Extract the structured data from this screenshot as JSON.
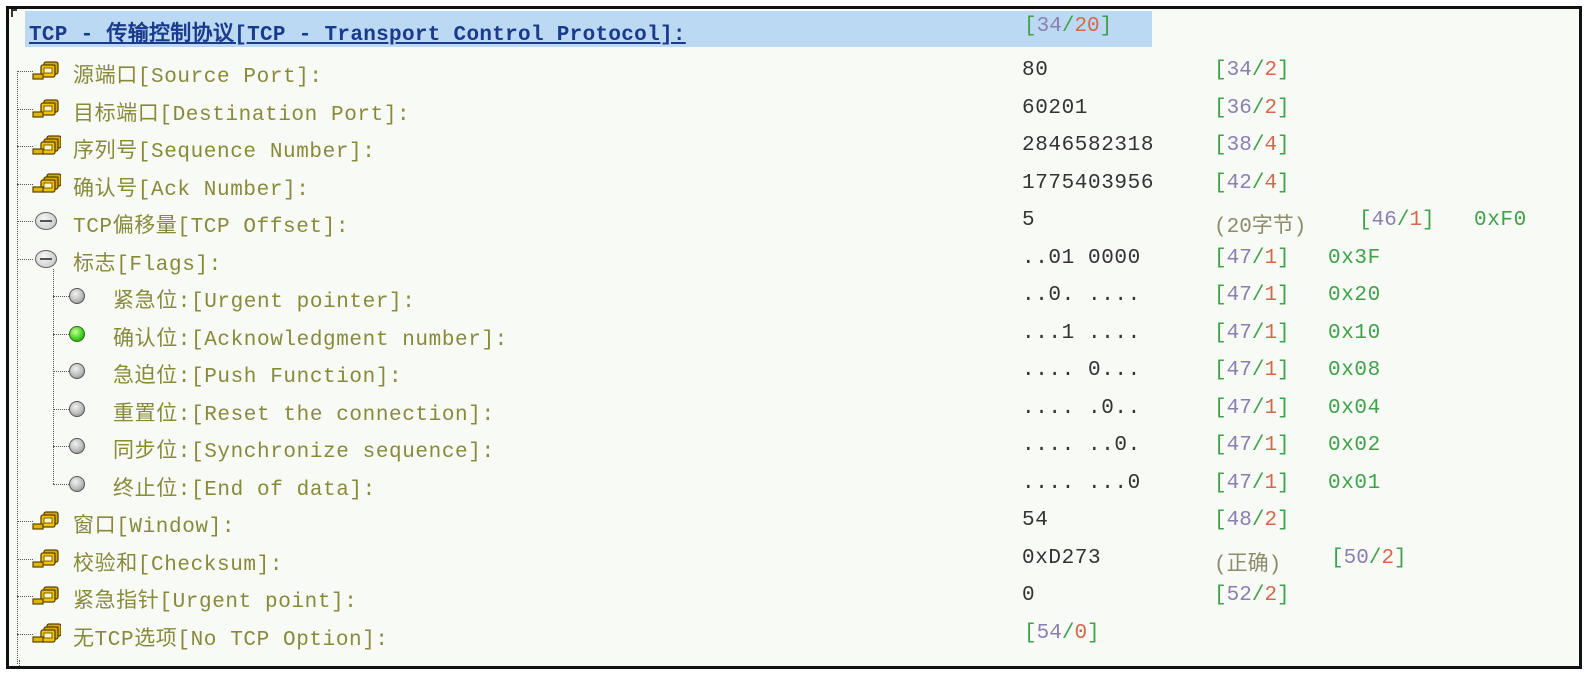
{
  "header": {
    "label": "TCP - 传输控制协议[TCP - Transport Control Protocol]:",
    "pos_a": "34",
    "pos_b": "20"
  },
  "rows": [
    {
      "label": "源端口[Source Port]:",
      "value": "80",
      "pos_a": "34",
      "pos_b": "2",
      "icon": "key-pair-icon"
    },
    {
      "label": "目标端口[Destination Port]:",
      "value": "60201",
      "pos_a": "36",
      "pos_b": "2",
      "icon": "key-pair-icon"
    },
    {
      "label": "序列号[Sequence Number]:",
      "value": "2846582318",
      "pos_a": "38",
      "pos_b": "4",
      "icon": "key-stack-icon"
    },
    {
      "label": "确认号[Ack Number]:",
      "value": "1775403956",
      "pos_a": "42",
      "pos_b": "4",
      "icon": "key-stack-icon"
    },
    {
      "label": "TCP偏移量[TCP Offset]:",
      "value": "5",
      "note": "(20字节)",
      "pos_a": "46",
      "pos_b": "1",
      "hex": "0xF0",
      "icon": "collapse-minus-icon"
    },
    {
      "label": "标志[Flags]:",
      "value": "..01 0000",
      "pos_a": "47",
      "pos_b": "1",
      "hex": "0x3F",
      "icon": "collapse-minus-icon"
    },
    {
      "label": "紧急位:[Urgent pointer]:",
      "value": "..0. ....",
      "pos_a": "47",
      "pos_b": "1",
      "hex": "0x20",
      "icon": "gray-dot-icon"
    },
    {
      "label": "确认位:[Acknowledgment number]:",
      "value": "...1 ....",
      "pos_a": "47",
      "pos_b": "1",
      "hex": "0x10",
      "icon": "green-dot-icon"
    },
    {
      "label": "急迫位:[Push Function]:",
      "value": ".... 0...",
      "pos_a": "47",
      "pos_b": "1",
      "hex": "0x08",
      "icon": "gray-dot-icon"
    },
    {
      "label": "重置位:[Reset the connection]:",
      "value": ".... .0..",
      "pos_a": "47",
      "pos_b": "1",
      "hex": "0x04",
      "icon": "gray-dot-icon"
    },
    {
      "label": "同步位:[Synchronize sequence]:",
      "value": ".... ..0.",
      "pos_a": "47",
      "pos_b": "1",
      "hex": "0x02",
      "icon": "gray-dot-icon"
    },
    {
      "label": "终止位:[End of data]:",
      "value": ".... ...0",
      "pos_a": "47",
      "pos_b": "1",
      "hex": "0x01",
      "icon": "gray-dot-icon"
    },
    {
      "label": "窗口[Window]:",
      "value": "54",
      "pos_a": "48",
      "pos_b": "2",
      "icon": "key-pair-icon"
    },
    {
      "label": "校验和[Checksum]:",
      "value": "0xD273",
      "note": "(正确)",
      "pos_a": "50",
      "pos_b": "2",
      "icon": "key-pair-icon"
    },
    {
      "label": "紧急指针[Urgent point]:",
      "value": "0",
      "pos_a": "52",
      "pos_b": "2",
      "icon": "key-pair-icon"
    },
    {
      "label": "无TCP选项[No TCP Option]:",
      "value": "",
      "pos_a": "54",
      "pos_b": "0",
      "icon": "key-stack-icon"
    }
  ],
  "colors": {
    "selection": "#bcd9f3",
    "label": "#888a3a",
    "position": "#3fa24a",
    "offset": "#8a7fb0",
    "length": "#d06a4a"
  }
}
